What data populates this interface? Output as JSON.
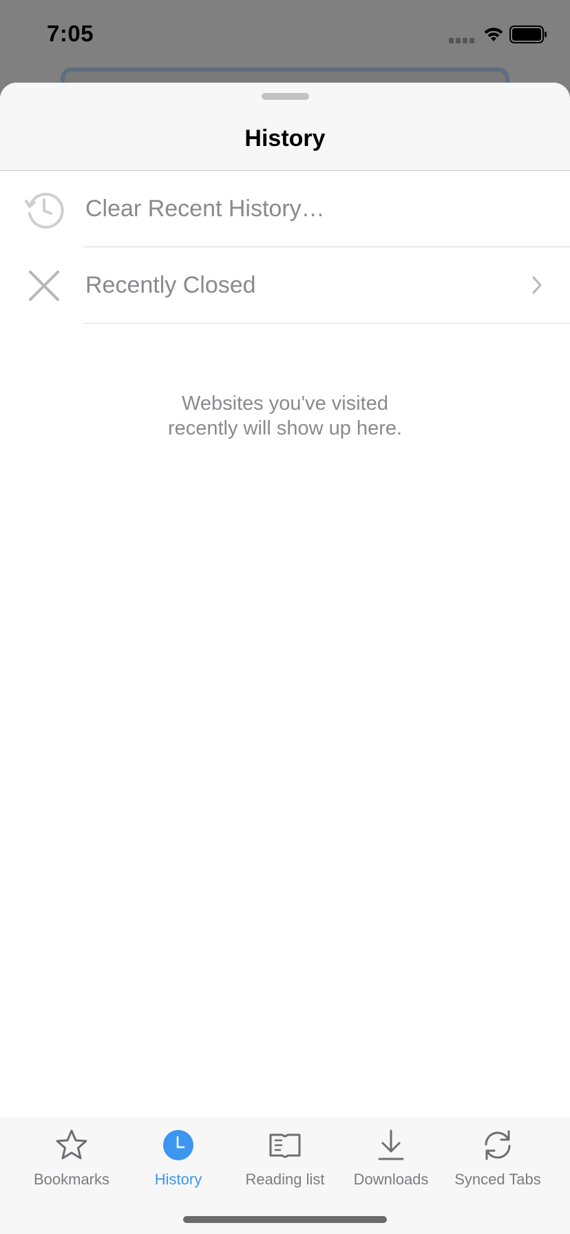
{
  "status_bar": {
    "time": "7:05",
    "icons": [
      "signal-icon",
      "wifi-icon",
      "battery-icon"
    ]
  },
  "sheet": {
    "title": "History",
    "rows": [
      {
        "label": "Clear Recent History…",
        "icon": "history-clock-icon"
      },
      {
        "label": "Recently Closed",
        "icon": "close-icon",
        "has_chevron": true
      }
    ],
    "empty_message": "Websites you've visited recently will show up here."
  },
  "tab_bar": {
    "tabs": [
      {
        "label": "Bookmarks",
        "icon": "star-icon",
        "active": false
      },
      {
        "label": "History",
        "icon": "clock-icon",
        "active": true
      },
      {
        "label": "Reading list",
        "icon": "book-icon",
        "active": false
      },
      {
        "label": "Downloads",
        "icon": "download-icon",
        "active": false
      },
      {
        "label": "Synced Tabs",
        "icon": "sync-icon",
        "active": false
      }
    ]
  },
  "colors": {
    "accent": "#3c96f0",
    "secondary_text": "#8a8a8e",
    "dimmed_background": "#808080"
  }
}
